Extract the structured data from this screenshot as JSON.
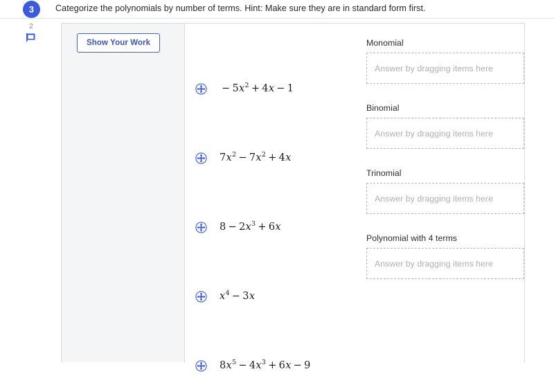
{
  "header": {
    "question_number": "3",
    "title": "Categorize the polynomials by number of terms. Hint: Make sure they are in standard form first."
  },
  "gutter": {
    "points": "2",
    "flag_icon": "comment-flag-icon"
  },
  "work_pane": {
    "show_work_label": "Show Your Work"
  },
  "drag_items": [
    {
      "handle_icon": "drag-move-icon",
      "expression": "-5x^2 + 4x - 1",
      "parts": [
        {
          "t": "op",
          "v": "−"
        },
        {
          "t": "num",
          "v": "5"
        },
        {
          "t": "var",
          "v": "x"
        },
        {
          "t": "sup",
          "v": "2"
        },
        {
          "t": "op",
          "v": "+"
        },
        {
          "t": "num",
          "v": "4"
        },
        {
          "t": "var",
          "v": "x"
        },
        {
          "t": "op",
          "v": "−"
        },
        {
          "t": "num",
          "v": "1"
        }
      ]
    },
    {
      "handle_icon": "drag-move-icon",
      "expression": "7x^2 - 7x^2 + 4x",
      "parts": [
        {
          "t": "num",
          "v": "7"
        },
        {
          "t": "var",
          "v": "x"
        },
        {
          "t": "sup",
          "v": "2"
        },
        {
          "t": "op",
          "v": "−"
        },
        {
          "t": "num",
          "v": "7"
        },
        {
          "t": "var",
          "v": "x"
        },
        {
          "t": "sup",
          "v": "2"
        },
        {
          "t": "op",
          "v": "+"
        },
        {
          "t": "num",
          "v": "4"
        },
        {
          "t": "var",
          "v": "x"
        }
      ]
    },
    {
      "handle_icon": "drag-move-icon",
      "expression": "8 - 2x^3 + 6x",
      "parts": [
        {
          "t": "num",
          "v": "8"
        },
        {
          "t": "op",
          "v": "−"
        },
        {
          "t": "num",
          "v": "2"
        },
        {
          "t": "var",
          "v": "x"
        },
        {
          "t": "sup",
          "v": "3"
        },
        {
          "t": "op",
          "v": "+"
        },
        {
          "t": "num",
          "v": "6"
        },
        {
          "t": "var",
          "v": "x"
        }
      ]
    },
    {
      "handle_icon": "drag-move-icon",
      "expression": "x^4 - 3x",
      "parts": [
        {
          "t": "var",
          "v": "x"
        },
        {
          "t": "sup",
          "v": "4"
        },
        {
          "t": "op",
          "v": "−"
        },
        {
          "t": "num",
          "v": "3"
        },
        {
          "t": "var",
          "v": "x"
        }
      ]
    },
    {
      "handle_icon": "drag-move-icon",
      "expression": "8x^5 - 4x^3 + 6x - 9",
      "parts": [
        {
          "t": "num",
          "v": "8"
        },
        {
          "t": "var",
          "v": "x"
        },
        {
          "t": "sup",
          "v": "5"
        },
        {
          "t": "op",
          "v": "−"
        },
        {
          "t": "num",
          "v": "4"
        },
        {
          "t": "var",
          "v": "x"
        },
        {
          "t": "sup",
          "v": "3"
        },
        {
          "t": "op",
          "v": "+"
        },
        {
          "t": "num",
          "v": "6"
        },
        {
          "t": "var",
          "v": "x"
        },
        {
          "t": "op",
          "v": "−"
        },
        {
          "t": "num",
          "v": "9"
        }
      ]
    }
  ],
  "drop_targets": [
    {
      "label": "Monomial",
      "placeholder": "Answer by dragging items here",
      "value": ""
    },
    {
      "label": "Binomial",
      "placeholder": "Answer by dragging items here",
      "value": ""
    },
    {
      "label": "Trinomial",
      "placeholder": "Answer by dragging items here",
      "value": ""
    },
    {
      "label": "Polynomial with 4 terms",
      "placeholder": "Answer by dragging items here",
      "value": ""
    }
  ],
  "colors": {
    "badge_blue": "#3b5bdb",
    "button_blue": "#3b53b5",
    "handle_blue": "#3b5bdb",
    "pane_gray": "#f4f5f7",
    "border_gray": "#dcdcdf",
    "placeholder_gray": "#b0b0b5"
  }
}
